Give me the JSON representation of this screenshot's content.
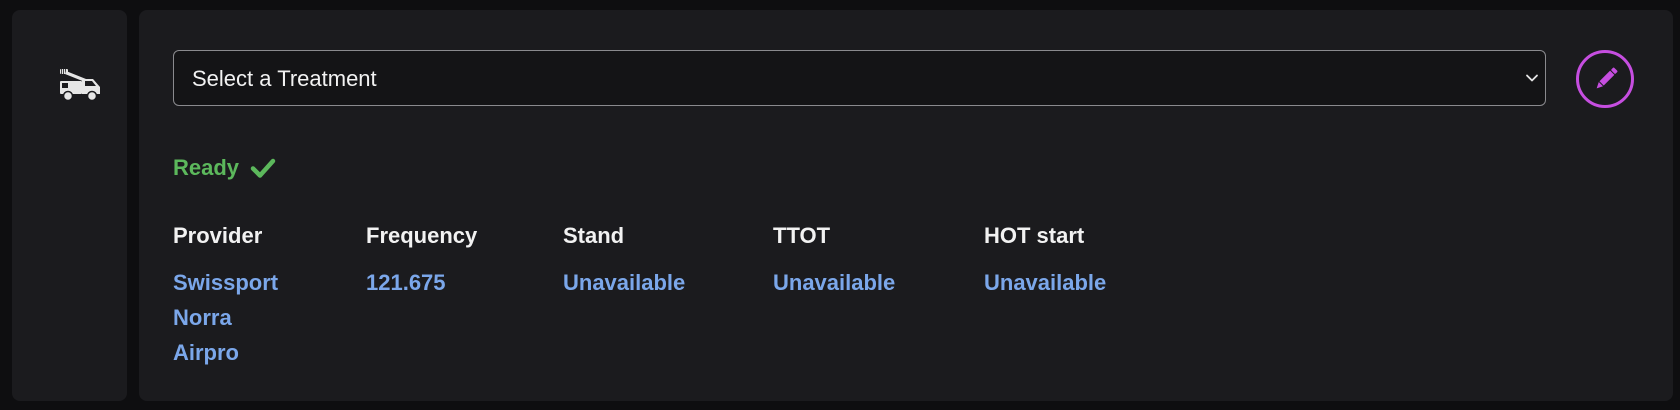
{
  "sidebar": {
    "icon": "deicing-truck-icon"
  },
  "treatment": {
    "placeholder": "Select a Treatment",
    "icon": "chevron-down-icon"
  },
  "edit_button": {
    "icon": "pencil-icon",
    "color": "#c64ee0"
  },
  "status": {
    "label": "Ready",
    "icon": "check-icon",
    "color": "#5cb85c"
  },
  "details": {
    "provider": {
      "header": "Provider",
      "values": [
        "Swissport",
        "Norra",
        "Airpro"
      ]
    },
    "frequency": {
      "header": "Frequency",
      "value": "121.675"
    },
    "stand": {
      "header": "Stand",
      "value": "Unavailable"
    },
    "ttot": {
      "header": "TTOT",
      "value": "Unavailable"
    },
    "hot_start": {
      "header": "HOT start",
      "value": "Unavailable"
    }
  },
  "colors": {
    "value_link": "#7ba7ea",
    "panel_bg": "#1b1b1e",
    "page_bg": "#0e0e10"
  }
}
